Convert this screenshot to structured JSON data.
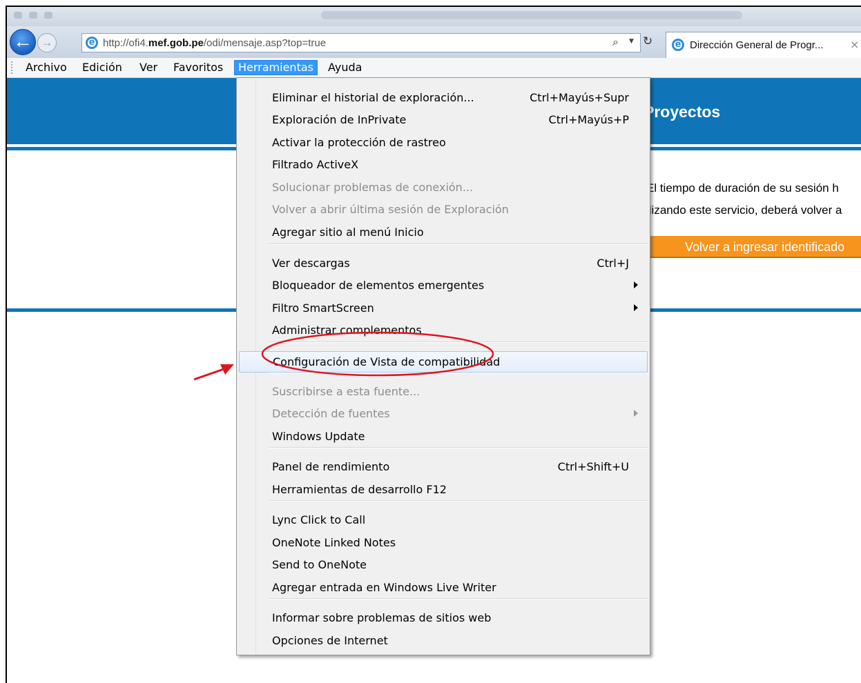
{
  "browser": {
    "url_prefix": "http://ofi4.",
    "url_domain": "mef.gob.pe",
    "url_path": "/odi/mensaje.asp?top=true",
    "search_icon": "⌕",
    "dropdown_arrow": "▼",
    "refresh_icon": "↻",
    "tab_title": "Dirección General de Progr...",
    "tab_close": "×",
    "back_icon": "←",
    "forward_icon": "→",
    "ie_icon": "e"
  },
  "menubar": {
    "items": [
      "Archivo",
      "Edición",
      "Ver",
      "Favoritos",
      "Herramientas",
      "Ayuda"
    ],
    "active": "Herramientas"
  },
  "page": {
    "banner_title": "Proyectos",
    "message_line1": "El tiempo de duración de su sesión h",
    "message_line2": "ilizando este servicio, deberá volver a",
    "button_label": "Volver a ingresar identificado",
    "banner_color": "#0f75b8",
    "button_color": "#f7941d"
  },
  "tools_menu": {
    "items": [
      {
        "label": "Eliminar el historial de exploración...",
        "shortcut": "Ctrl+Mayús+Supr"
      },
      {
        "label": "Exploración de InPrivate",
        "shortcut": "Ctrl+Mayús+P"
      },
      {
        "label": "Activar la protección de rastreo"
      },
      {
        "label": "Filtrado ActiveX"
      },
      {
        "label": "Solucionar problemas de conexión...",
        "disabled": true
      },
      {
        "label": "Volver a abrir última sesión de Exploración",
        "disabled": true
      },
      {
        "label": "Agregar sitio al menú Inicio"
      },
      {
        "label": "Ver descargas",
        "shortcut": "Ctrl+J"
      },
      {
        "label": "Bloqueador de elementos emergentes",
        "submenu": true
      },
      {
        "label": "Filtro SmartScreen",
        "submenu": true
      },
      {
        "label": "Administrar complementos"
      },
      {
        "label": "Configuración de Vista de compatibilidad",
        "highlighted": true
      },
      {
        "label": "Suscribirse a esta fuente...",
        "disabled": true
      },
      {
        "label": "Detección de fuentes",
        "disabled": true,
        "submenu": true
      },
      {
        "label": "Windows Update"
      },
      {
        "label": "Panel de rendimiento",
        "shortcut": "Ctrl+Shift+U"
      },
      {
        "label": "Herramientas de desarrollo F12"
      },
      {
        "label": "Lync Click to Call"
      },
      {
        "label": "OneNote Linked Notes"
      },
      {
        "label": "Send to OneNote"
      },
      {
        "label": "Agregar entrada en Windows Live Writer"
      },
      {
        "label": "Informar sobre problemas de sitios web"
      },
      {
        "label": "Opciones de Internet"
      }
    ]
  },
  "annotation": {
    "color": "#e0141c"
  }
}
